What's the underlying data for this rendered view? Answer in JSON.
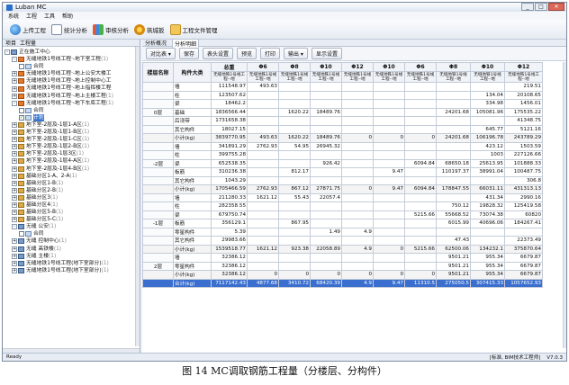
{
  "window": {
    "title": "Luban MC"
  },
  "menu": [
    "系统",
    "工程",
    "工具",
    "帮助"
  ],
  "toolbar": [
    {
      "label": "上传工程",
      "icon": "upload-icon"
    },
    {
      "label": "统计分析",
      "icon": "stats-icon"
    },
    {
      "label": "审核分析",
      "icon": "audit-icon"
    },
    {
      "label": "筑城扳",
      "icon": "tool-icon"
    },
    {
      "label": "工程文件管理",
      "icon": "folder-icon"
    }
  ],
  "left_tabs": [
    "项目",
    "工程量"
  ],
  "tree": [
    {
      "label": "正在施工中心",
      "level": 1,
      "exp": "-",
      "icon": "g"
    },
    {
      "label": "无缝地铁1号线工程·-地下室工程",
      "count": "(1)",
      "level": 2,
      "exp": "-",
      "icon": "o"
    },
    {
      "label": "合同",
      "level": 3,
      "cb": true,
      "icon": "b"
    },
    {
      "label": "无缝地铁1号线工程·-地上公安大楼工",
      "count": "",
      "level": 2,
      "exp": "+",
      "icon": "o"
    },
    {
      "label": "无缝地铁1号线工程·-地上控制中心工",
      "count": "",
      "level": 2,
      "exp": "+",
      "icon": "o"
    },
    {
      "label": "无缝地铁1号线工程·-地上指挥楼工程",
      "count": "",
      "level": 2,
      "exp": "+",
      "icon": "o"
    },
    {
      "label": "无缝地铁1号线工程·-地上主楼工程",
      "count": "(1)",
      "level": 2,
      "exp": "+",
      "icon": "o"
    },
    {
      "label": "无缝地铁1号线工程·-地下车库工程",
      "count": "(1)",
      "level": 2,
      "exp": "-",
      "icon": "o"
    },
    {
      "label": "合同",
      "level": 3,
      "cb": true,
      "icon": "b"
    },
    {
      "label": "计划",
      "level": 3,
      "cb": true,
      "checked": true,
      "sel": true,
      "icon": "b"
    },
    {
      "label": "地下室-2层及-1层1-A区",
      "count": "(1)",
      "level": 2,
      "exp": "+",
      "icon": ""
    },
    {
      "label": "地下室-2层及-1层1-B区",
      "count": "(1)",
      "level": 2,
      "exp": "+",
      "icon": ""
    },
    {
      "label": "地下室-2层及-1层1-C区",
      "count": "(1)",
      "level": 2,
      "exp": "+",
      "icon": ""
    },
    {
      "label": "地下室-2层及-1层2-B区",
      "count": "(1)",
      "level": 2,
      "exp": "+",
      "icon": ""
    },
    {
      "label": "地下室-2层及-1层3区",
      "count": "(1)",
      "level": 2,
      "exp": "+",
      "icon": ""
    },
    {
      "label": "地下室-2层及-1层4-A区",
      "count": "(1)",
      "level": 2,
      "exp": "+",
      "icon": ""
    },
    {
      "label": "地下室-2层及-1层4-B区",
      "count": "(1)",
      "level": 2,
      "exp": "+",
      "icon": ""
    },
    {
      "label": "基础分区1-A、2-A",
      "count": "(1)",
      "level": 2,
      "exp": "+",
      "icon": ""
    },
    {
      "label": "基础分区1-B",
      "count": "(1)",
      "level": 2,
      "exp": "+",
      "icon": ""
    },
    {
      "label": "基础分区2-B",
      "count": "(1)",
      "level": 2,
      "exp": "+",
      "icon": ""
    },
    {
      "label": "基础分区3",
      "count": "(1)",
      "level": 2,
      "exp": "+",
      "icon": ""
    },
    {
      "label": "基础分区4",
      "count": "(1)",
      "level": 2,
      "exp": "+",
      "icon": ""
    },
    {
      "label": "基础分区5-B",
      "count": "(1)",
      "level": 2,
      "exp": "+",
      "icon": ""
    },
    {
      "label": "基础分区5-C",
      "count": "(1)",
      "level": 2,
      "exp": "+",
      "icon": ""
    },
    {
      "label": "无缝 公安",
      "count": "(1)",
      "level": 2,
      "exp": "-",
      "icon": "g"
    },
    {
      "label": "合同",
      "level": 3,
      "cb": true,
      "icon": "b"
    },
    {
      "label": "无缝 控制中心",
      "count": "(1)",
      "level": 2,
      "exp": "+",
      "icon": "g"
    },
    {
      "label": "无缝 高铁楼",
      "count": "(1)",
      "level": 2,
      "exp": "+",
      "icon": "g"
    },
    {
      "label": "无缝 主楼",
      "count": "(1)",
      "level": 2,
      "exp": "+",
      "icon": "g"
    },
    {
      "label": "无缝地铁1号线工程(地下室部分)",
      "count": "(1)",
      "level": 2,
      "exp": "+",
      "icon": "g"
    },
    {
      "label": "无缝地铁1号线工程(地下室部分)",
      "count": "(1)",
      "level": 2,
      "exp": "+",
      "icon": "g"
    }
  ],
  "right_tabs": [
    "分析概况",
    "分析明细"
  ],
  "actions": [
    "对比表",
    "保存",
    "表头设置",
    "预览",
    "打印",
    "输出",
    "显示设置"
  ],
  "table": {
    "col_headers": [
      "楼层名称",
      "构件大类",
      "总重",
      "Φ6",
      "Φ8",
      "Φ10",
      "Φ12",
      "Φ10",
      "Φ6",
      "Φ8",
      "Φ10",
      "Φ12"
    ],
    "sub_header": "无缝地铁1号线工程--地",
    "rows": [
      {
        "floor": "",
        "type": "墙",
        "vals": [
          "111548.97",
          "493.63",
          "",
          "",
          "",
          "",
          "",
          "",
          "",
          "219.51"
        ]
      },
      {
        "floor": "",
        "type": "柱",
        "vals": [
          "123507.62",
          "",
          "",
          "",
          "",
          "",
          "",
          "",
          "134.04",
          "20108.65"
        ]
      },
      {
        "floor": "",
        "type": "梁",
        "vals": [
          "18462.2",
          "",
          "",
          "",
          "",
          "",
          "",
          "",
          "334.98",
          "1456.01"
        ]
      },
      {
        "floor": "0层",
        "type": "基础",
        "vals": [
          "1836566.44",
          "",
          "1620.22",
          "18489.76",
          "",
          "",
          "",
          "24201.68",
          "105081.96",
          "175535.22"
        ]
      },
      {
        "floor": "",
        "type": "后浇带",
        "vals": [
          "1731658.38",
          "",
          "",
          "",
          "",
          "",
          "",
          "",
          "",
          "41348.75"
        ]
      },
      {
        "floor": "",
        "type": "其它构件",
        "vals": [
          "18027.15",
          "",
          "",
          "",
          "",
          "",
          "",
          "",
          "645.77",
          "5121.16"
        ]
      },
      {
        "floor": "",
        "type": "小计(kg)",
        "sub": true,
        "vals": [
          "3839770.95",
          "493.63",
          "1620.22",
          "18489.76",
          "0",
          "0",
          "0",
          "24201.68",
          "106196.78",
          "243789.29"
        ]
      },
      {
        "floor": "",
        "type": "墙",
        "vals": [
          "341891.29",
          "2762.93",
          "54.95",
          "26945.32",
          "",
          "",
          "",
          "",
          "423.12",
          "1503.59"
        ]
      },
      {
        "floor": "",
        "type": "柱",
        "vals": [
          "399755.28",
          "",
          "",
          "",
          "",
          "",
          "",
          "",
          "1003",
          "227126.66"
        ]
      },
      {
        "floor": "-2层",
        "type": "梁",
        "vals": [
          "652538.35",
          "",
          "",
          "926.42",
          "",
          "",
          "6094.84",
          "68650.18",
          "25613.95",
          "101888.33"
        ]
      },
      {
        "floor": "",
        "type": "板筋",
        "vals": [
          "310236.38",
          "",
          "812.17",
          "",
          "",
          "9.47",
          "",
          "110197.37",
          "38991.04",
          "100487.75"
        ]
      },
      {
        "floor": "",
        "type": "其它构件",
        "vals": [
          "1043.29",
          "",
          "",
          "",
          "",
          "",
          "",
          "",
          "",
          "306.8"
        ]
      },
      {
        "floor": "",
        "type": "小计(kg)",
        "sub": true,
        "vals": [
          "1705466.59",
          "2762.93",
          "867.12",
          "27871.75",
          "0",
          "9.47",
          "6094.84",
          "178847.55",
          "66031.11",
          "431313.13"
        ]
      },
      {
        "floor": "",
        "type": "墙",
        "vals": [
          "211280.33",
          "1621.12",
          "55.43",
          "22057.4",
          "",
          "",
          "",
          "",
          "431.34",
          "2990.16"
        ]
      },
      {
        "floor": "",
        "type": "柱",
        "vals": [
          "282358.55",
          "",
          "",
          "",
          "",
          "",
          "",
          "750.12",
          "19828.32",
          "125419.58"
        ]
      },
      {
        "floor": "",
        "type": "梁",
        "vals": [
          "679750.74",
          "",
          "",
          "",
          "",
          "",
          "5215.66",
          "55668.52",
          "73074.38",
          "60820"
        ]
      },
      {
        "floor": "-1层",
        "type": "板筋",
        "vals": [
          "356129.1",
          "",
          "867.95",
          "",
          "",
          "",
          "",
          "6015.99",
          "40696.06",
          "184267.41"
        ]
      },
      {
        "floor": "",
        "type": "零星构件",
        "vals": [
          "5.39",
          "",
          "",
          "1.49",
          "4.9",
          "",
          "",
          "",
          "",
          ""
        ]
      },
      {
        "floor": "",
        "type": "其它构件",
        "vals": [
          "29983.66",
          "",
          "",
          "",
          "",
          "",
          "",
          "47.43",
          "",
          "22373.49"
        ]
      },
      {
        "floor": "",
        "type": "小计(kg)",
        "sub": true,
        "vals": [
          "1539518.77",
          "1621.12",
          "923.38",
          "22058.89",
          "4.9",
          "0",
          "5215.66",
          "62500.06",
          "134232.1",
          "375870.64"
        ]
      },
      {
        "floor": "",
        "type": "墙",
        "vals": [
          "32386.12",
          "",
          "",
          "",
          "",
          "",
          "",
          "9501.21",
          "955.34",
          "6679.87"
        ]
      },
      {
        "floor": "2层",
        "type": "零星构件",
        "vals": [
          "32386.12",
          "",
          "",
          "",
          "",
          "",
          "",
          "9501.21",
          "955.34",
          "6679.87"
        ]
      },
      {
        "floor": "",
        "type": "小计(kg)",
        "sub": true,
        "vals": [
          "32386.12",
          "0",
          "0",
          "0",
          "0",
          "0",
          "0",
          "9501.21",
          "955.34",
          "6679.87"
        ]
      },
      {
        "floor": "",
        "type": "合计(kg)",
        "total": true,
        "vals": [
          "7117142.43",
          "4877.68",
          "3410.72",
          "68420.39",
          "4.9",
          "9.47",
          "11310.5",
          "275050.5",
          "307415.33",
          "1057652.93"
        ]
      }
    ]
  },
  "status": {
    "left": "Ready",
    "right": "[标准, BIM技术工程师]",
    "version": "V7.0.3"
  },
  "caption": "图 14 MC调取钢筋工程量（分楼层、分构件）"
}
